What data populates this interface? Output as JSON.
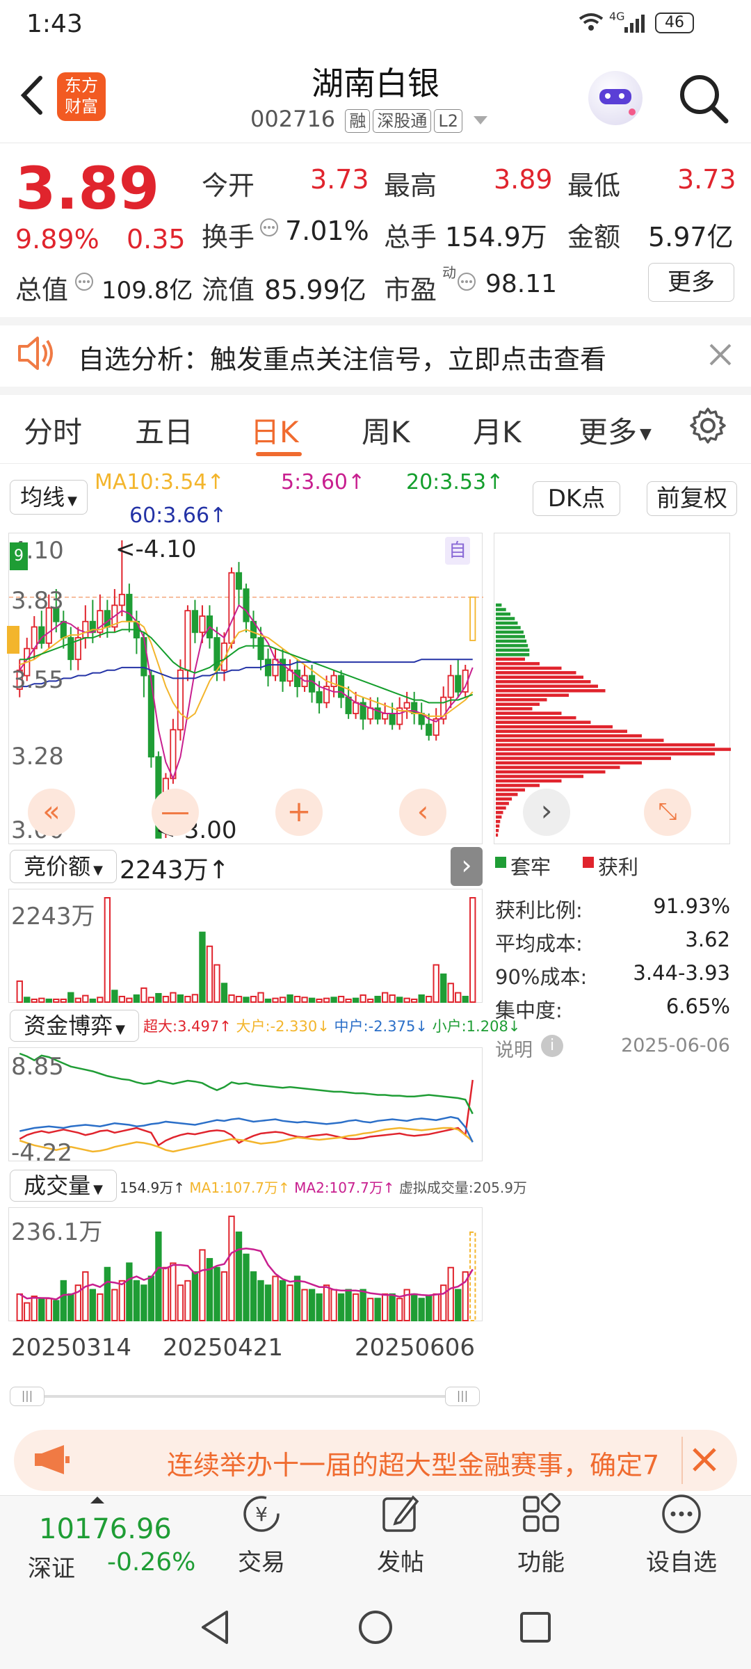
{
  "status": {
    "time": "1:43",
    "net": "4G",
    "battery": "46"
  },
  "header": {
    "brand_line1": "东方",
    "brand_line2": "财富",
    "stock_name": "湖南白银",
    "stock_code": "002716",
    "tags": [
      "融",
      "深股通",
      "L2"
    ]
  },
  "quote": {
    "price": "3.89",
    "change_pct": "9.89%",
    "change": "0.35",
    "open_label": "今开",
    "open": "3.73",
    "high_label": "最高",
    "high": "3.89",
    "low_label": "最低",
    "low": "3.73",
    "turnover_label": "换手",
    "turnover": "7.01%",
    "volume_label": "总手",
    "volume": "154.9万",
    "amount_label": "金额",
    "amount": "5.97亿",
    "mktcap_label": "总值",
    "mktcap": "109.8亿",
    "float_label": "流值",
    "float": "85.99亿",
    "pe_label": "市盈",
    "pe_sup": "动",
    "pe": "98.11",
    "more": "更多"
  },
  "banner": {
    "text": "自选分析：触发重点关注信号，立即点击查看"
  },
  "tabs": [
    "分时",
    "五日",
    "日K",
    "周K",
    "月K",
    "更多"
  ],
  "active_tab": "日K",
  "ma": {
    "selector": "均线",
    "ma10": "MA10:3.54↑",
    "ma5": "5:3.60↑",
    "ma20": "20:3.53↑",
    "ma60": "60:3.66↑",
    "dk": "DK点",
    "adjust": "前复权"
  },
  "kchart": {
    "axis": [
      "4.10",
      "3.83",
      "3.55",
      "3.28",
      "3.00"
    ],
    "high_note": "<-4.10",
    "low_note": "<-3.00",
    "self_tag": "自"
  },
  "auction": {
    "selector": "竞价额",
    "value": "2243万↑",
    "axis_top": "2243万"
  },
  "capital": {
    "selector": "资金博弈",
    "super": "超大:3.497↑",
    "big": "大户:-2.330↓",
    "mid": "中户:-2.375↓",
    "small": "小户:1.208↓",
    "axis_top": "8.85",
    "axis_bottom": "-4.22"
  },
  "vol": {
    "selector": "成交量",
    "total": "154.9万↑",
    "ma1": "MA1:107.7万↑",
    "ma2": "MA2:107.7万↑",
    "virtual": "虚拟成交量:205.9万",
    "axis_top": "236.1万"
  },
  "dates": [
    "20250314",
    "20250421",
    "20250606"
  ],
  "chip": {
    "legend_trapped": "套牢",
    "legend_profit": "获利",
    "rows": [
      {
        "label": "获利比例:",
        "value": "91.93%"
      },
      {
        "label": "平均成本:",
        "value": "3.62"
      },
      {
        "label": "90%成本:",
        "value": "3.44-3.93"
      },
      {
        "label": "集中度:",
        "value": "6.65%"
      }
    ],
    "note": "说明",
    "date": "2025-06-06"
  },
  "promo": {
    "text": "连续举办十一届的超大型金融赛事，确定7"
  },
  "bottom": {
    "index_value": "10176.96",
    "index_name": "深证",
    "index_change": "-0.26%",
    "trade": "交易",
    "post": "发帖",
    "func": "功能",
    "watch": "设自选"
  },
  "colors": {
    "red": "#e0242d",
    "green": "#1f9d35",
    "orange": "#f07a44",
    "ma10": "#f3b52c",
    "ma5": "#c81f8f",
    "ma20": "#139e2c",
    "ma60": "#2433a6"
  },
  "chart_data": {
    "type": "candlestick",
    "ylim": [
      3.0,
      4.1
    ],
    "candles": [
      [
        3.55,
        3.62,
        3.66,
        3.52
      ],
      [
        3.6,
        3.7,
        3.74,
        3.58
      ],
      [
        3.7,
        3.78,
        3.82,
        3.66
      ],
      [
        3.78,
        3.72,
        3.84,
        3.7
      ],
      [
        3.72,
        3.85,
        3.9,
        3.7
      ],
      [
        3.85,
        3.8,
        3.92,
        3.76
      ],
      [
        3.8,
        3.74,
        3.84,
        3.7
      ],
      [
        3.74,
        3.66,
        3.78,
        3.62
      ],
      [
        3.66,
        3.74,
        3.78,
        3.62
      ],
      [
        3.74,
        3.8,
        3.86,
        3.7
      ],
      [
        3.8,
        3.76,
        3.88,
        3.72
      ],
      [
        3.76,
        3.84,
        3.9,
        3.74
      ],
      [
        3.84,
        3.78,
        3.88,
        3.74
      ],
      [
        3.78,
        3.86,
        3.92,
        3.76
      ],
      [
        3.86,
        3.9,
        4.1,
        3.82
      ],
      [
        3.9,
        3.8,
        3.94,
        3.76
      ],
      [
        3.8,
        3.74,
        3.84,
        3.68
      ],
      [
        3.74,
        3.6,
        3.76,
        3.52
      ],
      [
        3.6,
        3.3,
        3.62,
        3.26
      ],
      [
        3.3,
        3.0,
        3.32,
        3.0
      ],
      [
        3.1,
        3.22,
        3.24,
        3.0
      ],
      [
        3.22,
        3.4,
        3.44,
        3.2
      ],
      [
        3.4,
        3.62,
        3.66,
        3.36
      ],
      [
        3.62,
        3.84,
        3.86,
        3.58
      ],
      [
        3.84,
        3.76,
        3.88,
        3.72
      ],
      [
        3.76,
        3.82,
        3.86,
        3.72
      ],
      [
        3.82,
        3.74,
        3.86,
        3.7
      ],
      [
        3.74,
        3.62,
        3.78,
        3.58
      ],
      [
        3.62,
        3.72,
        3.76,
        3.58
      ],
      [
        3.72,
        3.98,
        4.0,
        3.7
      ],
      [
        3.98,
        3.92,
        4.02,
        3.86
      ],
      [
        3.92,
        3.8,
        3.94,
        3.76
      ],
      [
        3.8,
        3.74,
        3.84,
        3.7
      ],
      [
        3.74,
        3.66,
        3.78,
        3.62
      ],
      [
        3.66,
        3.6,
        3.7,
        3.56
      ],
      [
        3.6,
        3.66,
        3.7,
        3.58
      ],
      [
        3.66,
        3.58,
        3.7,
        3.54
      ],
      [
        3.58,
        3.62,
        3.66,
        3.56
      ],
      [
        3.62,
        3.56,
        3.66,
        3.52
      ],
      [
        3.56,
        3.6,
        3.64,
        3.54
      ],
      [
        3.6,
        3.54,
        3.64,
        3.5
      ],
      [
        3.54,
        3.5,
        3.58,
        3.46
      ],
      [
        3.5,
        3.56,
        3.6,
        3.48
      ],
      [
        3.56,
        3.6,
        3.62,
        3.52
      ],
      [
        3.6,
        3.52,
        3.62,
        3.48
      ],
      [
        3.52,
        3.46,
        3.56,
        3.44
      ],
      [
        3.46,
        3.5,
        3.54,
        3.44
      ],
      [
        3.5,
        3.44,
        3.52,
        3.4
      ],
      [
        3.44,
        3.48,
        3.52,
        3.42
      ],
      [
        3.48,
        3.44,
        3.52,
        3.42
      ],
      [
        3.44,
        3.46,
        3.5,
        3.42
      ],
      [
        3.46,
        3.42,
        3.5,
        3.4
      ],
      [
        3.42,
        3.48,
        3.52,
        3.4
      ],
      [
        3.48,
        3.5,
        3.54,
        3.44
      ],
      [
        3.5,
        3.46,
        3.54,
        3.42
      ],
      [
        3.46,
        3.42,
        3.5,
        3.4
      ],
      [
        3.42,
        3.38,
        3.46,
        3.36
      ],
      [
        3.38,
        3.44,
        3.48,
        3.36
      ],
      [
        3.44,
        3.52,
        3.56,
        3.42
      ],
      [
        3.52,
        3.6,
        3.64,
        3.48
      ],
      [
        3.6,
        3.54,
        3.66,
        3.52
      ],
      [
        3.54,
        3.62,
        3.64,
        3.52
      ],
      [
        3.73,
        3.89,
        3.89,
        3.73
      ]
    ],
    "ma5": [
      3.62,
      3.66,
      3.7,
      3.74,
      3.76,
      3.78,
      3.8,
      3.79,
      3.77,
      3.76,
      3.76,
      3.78,
      3.8,
      3.82,
      3.84,
      3.83,
      3.8,
      3.74,
      3.58,
      3.4,
      3.28,
      3.22,
      3.3,
      3.46,
      3.62,
      3.74,
      3.78,
      3.76,
      3.74,
      3.8,
      3.86,
      3.84,
      3.8,
      3.76,
      3.72,
      3.66,
      3.64,
      3.62,
      3.6,
      3.58,
      3.58,
      3.56,
      3.55,
      3.54,
      3.54,
      3.52,
      3.5,
      3.49,
      3.48,
      3.47,
      3.46,
      3.46,
      3.46,
      3.47,
      3.47,
      3.46,
      3.44,
      3.43,
      3.45,
      3.49,
      3.52,
      3.56,
      3.63
    ],
    "ma10": [
      3.64,
      3.65,
      3.66,
      3.68,
      3.7,
      3.72,
      3.74,
      3.75,
      3.75,
      3.76,
      3.77,
      3.77,
      3.78,
      3.79,
      3.8,
      3.8,
      3.8,
      3.78,
      3.72,
      3.64,
      3.56,
      3.5,
      3.46,
      3.44,
      3.46,
      3.52,
      3.58,
      3.62,
      3.66,
      3.72,
      3.76,
      3.77,
      3.76,
      3.75,
      3.74,
      3.72,
      3.7,
      3.68,
      3.66,
      3.64,
      3.62,
      3.6,
      3.58,
      3.57,
      3.56,
      3.55,
      3.53,
      3.52,
      3.51,
      3.5,
      3.49,
      3.48,
      3.47,
      3.47,
      3.46,
      3.46,
      3.45,
      3.45,
      3.45,
      3.47,
      3.49,
      3.51,
      3.54
    ],
    "ma20": [
      3.66,
      3.66,
      3.67,
      3.68,
      3.69,
      3.7,
      3.71,
      3.72,
      3.73,
      3.74,
      3.74,
      3.75,
      3.76,
      3.76,
      3.77,
      3.77,
      3.77,
      3.76,
      3.74,
      3.71,
      3.68,
      3.65,
      3.63,
      3.62,
      3.61,
      3.62,
      3.63,
      3.65,
      3.66,
      3.68,
      3.7,
      3.71,
      3.71,
      3.71,
      3.71,
      3.7,
      3.69,
      3.68,
      3.67,
      3.66,
      3.65,
      3.64,
      3.63,
      3.62,
      3.61,
      3.6,
      3.59,
      3.58,
      3.57,
      3.56,
      3.55,
      3.54,
      3.53,
      3.52,
      3.51,
      3.51,
      3.5,
      3.5,
      3.5,
      3.51,
      3.51,
      3.52,
      3.53
    ],
    "ma60": [
      3.56,
      3.56,
      3.57,
      3.57,
      3.58,
      3.58,
      3.59,
      3.59,
      3.6,
      3.6,
      3.61,
      3.61,
      3.62,
      3.62,
      3.63,
      3.63,
      3.63,
      3.63,
      3.62,
      3.61,
      3.6,
      3.59,
      3.59,
      3.59,
      3.59,
      3.6,
      3.6,
      3.61,
      3.61,
      3.62,
      3.62,
      3.63,
      3.63,
      3.63,
      3.64,
      3.64,
      3.64,
      3.64,
      3.65,
      3.65,
      3.65,
      3.65,
      3.65,
      3.65,
      3.65,
      3.65,
      3.65,
      3.65,
      3.65,
      3.65,
      3.65,
      3.65,
      3.65,
      3.65,
      3.65,
      3.66,
      3.66,
      3.66,
      3.66,
      3.66,
      3.66,
      3.66,
      3.66
    ],
    "volume": [
      60,
      40,
      55,
      50,
      50,
      45,
      90,
      60,
      80,
      110,
      70,
      60,
      120,
      70,
      90,
      130,
      90,
      80,
      100,
      200,
      120,
      130,
      80,
      90,
      110,
      160,
      140,
      120,
      110,
      236,
      200,
      150,
      110,
      90,
      80,
      100,
      90,
      80,
      100,
      70,
      70,
      60,
      80,
      70,
      60,
      70,
      60,
      70,
      50,
      50,
      60,
      60,
      50,
      70,
      60,
      50,
      55,
      60,
      80,
      120,
      70,
      110,
      200
    ],
    "auction": [
      450,
      100,
      60,
      80,
      60,
      60,
      60,
      200,
      80,
      140,
      60,
      100,
      2243,
      250,
      120,
      80,
      150,
      300,
      100,
      180,
      120,
      200,
      150,
      120,
      160,
      1500,
      1200,
      800,
      400,
      150,
      120,
      100,
      120,
      200,
      60,
      80,
      100,
      150,
      120,
      100,
      80,
      60,
      80,
      100,
      120,
      60,
      80,
      150,
      60,
      120,
      200,
      150,
      100,
      80,
      60,
      150,
      120,
      800,
      600,
      400,
      200,
      120,
      2243
    ],
    "capital": {
      "super": [
        -2,
        -1.5,
        -1.2,
        -1,
        -1.2,
        -1,
        -0.8,
        -1,
        -1.2,
        -1.5,
        -1.3,
        -1,
        -0.9,
        -1.2,
        -1,
        -0.8,
        -0.6,
        -0.9,
        -1.2,
        -2.8,
        -2.2,
        -1.8,
        -1.5,
        -1.3,
        -1.4,
        -1.2,
        -1.0,
        -0.9,
        -1.0,
        -1.5,
        -2.5,
        -2,
        -1.6,
        -1.3,
        -1.2,
        -1.1,
        -1.2,
        -1.5,
        -1.7,
        -1.8,
        -1.6,
        -1.5,
        -1.4,
        -1.6,
        -1.8,
        -2,
        -2,
        -1.9,
        -1.7,
        -1.6,
        -1.5,
        -1.4,
        -1.3,
        -1.5,
        -1.6,
        -1.5,
        -1.4,
        -1.2,
        -1,
        -0.8,
        -0.6,
        -1.5,
        5.5
      ],
      "big": [
        -2.2,
        -2.5,
        -2.8,
        -3.0,
        -3.2,
        -3.4,
        -3.2,
        -3.0,
        -3.2,
        -3.4,
        -3.6,
        -3.5,
        -3.3,
        -3.0,
        -2.8,
        -2.6,
        -2.4,
        -2.5,
        -2.7,
        -3.0,
        -3.4,
        -3.6,
        -3.4,
        -3.2,
        -3.0,
        -2.8,
        -2.6,
        -2.4,
        -2.2,
        -2.0,
        -2.1,
        -2.2,
        -2.4,
        -2.6,
        -2.5,
        -2.4,
        -2.2,
        -2.0,
        -1.8,
        -1.9,
        -2.0,
        -2.1,
        -2.0,
        -1.9,
        -1.8,
        -1.6,
        -1.5,
        -1.3,
        -1.2,
        -1.0,
        -0.8,
        -0.7,
        -0.6,
        -0.7,
        -0.8,
        -0.9,
        -0.8,
        -0.7,
        -0.6,
        -0.6,
        -0.8,
        -1.5,
        -2.3
      ],
      "mid": [
        -1,
        -0.8,
        -0.6,
        -0.5,
        -0.4,
        -0.5,
        -0.6,
        -0.4,
        -0.3,
        -0.2,
        -0.3,
        -0.4,
        -0.2,
        0,
        -0.1,
        -0.2,
        -0.4,
        -0.3,
        -0.1,
        0,
        0.2,
        0.1,
        0,
        -0.1,
        -0.2,
        0,
        0.2,
        0.4,
        0.3,
        0.5,
        0.6,
        0.4,
        0.2,
        0.3,
        0.4,
        0.5,
        0.3,
        0.2,
        0.1,
        0.2,
        0.1,
        0,
        -0.1,
        0,
        0.1,
        0.3,
        0.4,
        0.2,
        0.1,
        0.3,
        0.4,
        0.5,
        0.4,
        0.3,
        0.5,
        0.6,
        0.5,
        0.4,
        0.6,
        0.8,
        0.6,
        -0.5,
        -2.4
      ],
      "small": [
        8.85,
        8.5,
        8.0,
        8.6,
        8.4,
        8.0,
        7.6,
        7.2,
        7.0,
        6.8,
        6.6,
        6.3,
        6.0,
        5.8,
        5.6,
        5.5,
        5.2,
        5.0,
        5.1,
        5.4,
        5.2,
        5.0,
        5.2,
        5.4,
        5.3,
        5.1,
        4.6,
        4.2,
        4.6,
        5.2,
        5.0,
        5.1,
        4.9,
        4.8,
        4.7,
        4.6,
        4.5,
        4.6,
        4.5,
        4.4,
        4.3,
        4.2,
        4.1,
        4.0,
        4.0,
        3.9,
        3.8,
        3.8,
        3.7,
        3.6,
        3.6,
        3.5,
        3.5,
        3.4,
        3.4,
        3.5,
        3.6,
        3.5,
        3.4,
        3.3,
        3.2,
        3.0,
        1.2
      ]
    },
    "chip_dist": {
      "price_levels": [
        4.1,
        3.0
      ],
      "trapped": [
        0,
        0,
        0,
        0,
        0,
        0,
        0,
        0,
        0,
        0,
        0,
        0,
        0,
        0,
        8,
        14,
        20,
        26,
        30,
        34,
        38,
        40,
        42,
        44,
        46,
        46,
        0,
        0,
        0,
        0,
        0,
        0,
        0,
        0,
        0,
        0,
        0,
        0,
        0,
        0,
        0,
        0,
        0,
        0,
        0,
        0,
        0,
        0,
        0,
        0,
        0,
        0,
        0,
        0,
        0,
        0,
        0,
        0,
        0,
        0,
        0,
        0,
        0,
        0,
        0,
        0
      ],
      "profit": [
        0,
        0,
        0,
        0,
        0,
        0,
        0,
        0,
        0,
        0,
        0,
        0,
        0,
        0,
        0,
        0,
        0,
        0,
        0,
        0,
        0,
        0,
        0,
        0,
        0,
        0,
        40,
        60,
        90,
        110,
        120,
        130,
        140,
        150,
        100,
        70,
        60,
        50,
        90,
        110,
        130,
        160,
        180,
        200,
        230,
        300,
        380,
        300,
        240,
        200,
        170,
        150,
        120,
        90,
        60,
        40,
        30,
        22,
        18,
        14,
        10,
        8,
        6,
        5,
        4,
        3
      ]
    }
  }
}
